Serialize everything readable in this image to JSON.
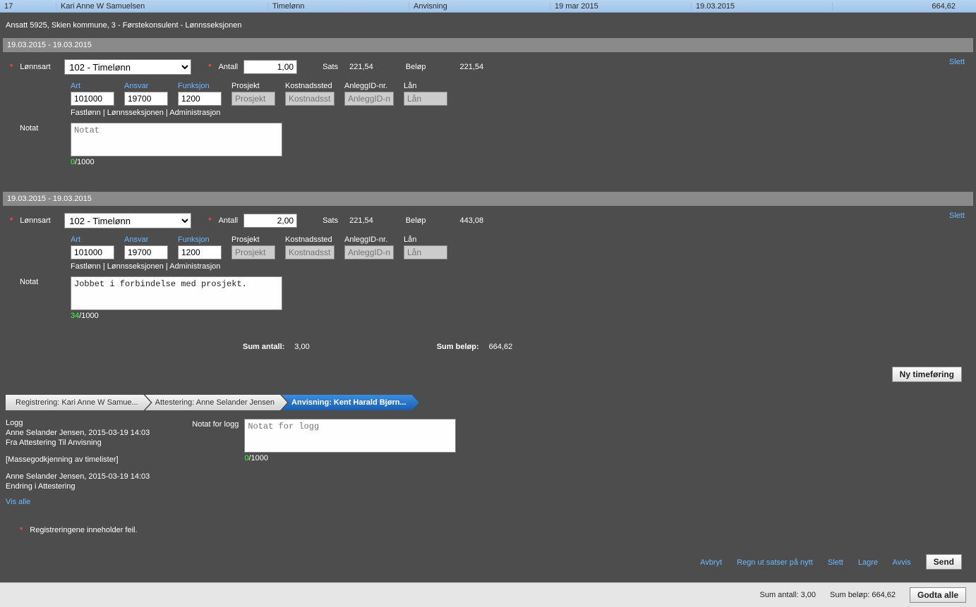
{
  "top": {
    "col1": "17",
    "col2": "Kari Anne W Samuelsen",
    "col3": "Timelønn",
    "col4": "Anvisning",
    "col5": "19 mar 2015",
    "col6": "19.03.2015",
    "col7": "664,62"
  },
  "employee_header": "Ansatt 5925, Skien kommune, 3 - Førstekonsulent - Lønnsseksjonen",
  "entries": [
    {
      "date_range": "19.03.2015 - 19.03.2015",
      "lonnsart_label": "Lønnsart",
      "lonnsart_value": "102 - Timelønn",
      "antall_label": "Antall",
      "antall_value": "1,00",
      "sats_label": "Sats",
      "sats_value": "221,54",
      "belop_label": "Beløp",
      "belop_value": "221,54",
      "slett": "Slett",
      "heads": {
        "art": "Art",
        "ansvar": "Ansvar",
        "funksjon": "Funksjon",
        "prosjekt": "Prosjekt",
        "kostnadssted": "Kostnadssted",
        "anleggid": "AnleggID-nr.",
        "lan": "Lån"
      },
      "vals": {
        "art": "101000",
        "ansvar": "19700",
        "funksjon": "1200",
        "prosjekt_ph": "Prosjekt",
        "kostnadssted_ph": "Kostnadsst",
        "anleggid_ph": "AnleggID-nr",
        "lan_ph": "Lån"
      },
      "breadcrumb": "Fastlønn | Lønnsseksjonen | Administrasjon",
      "notat_label": "Notat",
      "notat_placeholder": "Notat",
      "notat_value": "",
      "count": "0",
      "max": "/1000"
    },
    {
      "date_range": "19.03.2015 - 19.03.2015",
      "lonnsart_label": "Lønnsart",
      "lonnsart_value": "102 - Timelønn",
      "antall_label": "Antall",
      "antall_value": "2,00",
      "sats_label": "Sats",
      "sats_value": "221,54",
      "belop_label": "Beløp",
      "belop_value": "443,08",
      "slett": "Slett",
      "heads": {
        "art": "Art",
        "ansvar": "Ansvar",
        "funksjon": "Funksjon",
        "prosjekt": "Prosjekt",
        "kostnadssted": "Kostnadssted",
        "anleggid": "AnleggID-nr.",
        "lan": "Lån"
      },
      "vals": {
        "art": "101000",
        "ansvar": "19700",
        "funksjon": "1200",
        "prosjekt_ph": "Prosjekt",
        "kostnadssted_ph": "Kostnadsst",
        "anleggid_ph": "AnleggID-nr",
        "lan_ph": "Lån"
      },
      "breadcrumb": "Fastlønn | Lønnsseksjonen | Administrasjon",
      "notat_label": "Notat",
      "notat_placeholder": "",
      "notat_value": "Jobbet i forbindelse med prosjekt.",
      "count": "34",
      "max": "/1000"
    }
  ],
  "sums": {
    "antall_label": "Sum antall:",
    "antall_value": "3,00",
    "belop_label": "Sum beløp:",
    "belop_value": "664,62"
  },
  "new_entry_btn": "Ny timeføring",
  "workflow": {
    "step1": "Registrering: Kari Anne W Samue...",
    "step2": "Attestering: Anne Selander Jensen",
    "step3": "Anvisning: Kent Harald Bjørn..."
  },
  "log": {
    "title": "Logg",
    "line1": "Anne Selander Jensen, 2015-03-19 14:03",
    "line2": "Fra Attestering Til Anvisning",
    "line3": "[Massegodkjenning av timelister]",
    "line4": "Anne Selander Jensen, 2015-03-19 14:03",
    "line5": "Endring i Attestering",
    "vis_alle": "Vis alle"
  },
  "log_note": {
    "label": "Notat for logg",
    "placeholder": "Notat for logg",
    "count": "0",
    "max": "/1000"
  },
  "error_text": "Registreringene inneholder feil.",
  "actions": {
    "avbryt": "Avbryt",
    "regn": "Regn ut satser på nytt",
    "slett": "Slett",
    "lagre": "Lagre",
    "avvis": "Avvis",
    "send": "Send"
  },
  "bottom": {
    "sum_antall_label": "Sum antall:",
    "sum_antall_value": "3,00",
    "sum_belop_label": "Sum beløp:",
    "sum_belop_value": "664,62",
    "godta_alle": "Godta alle"
  }
}
